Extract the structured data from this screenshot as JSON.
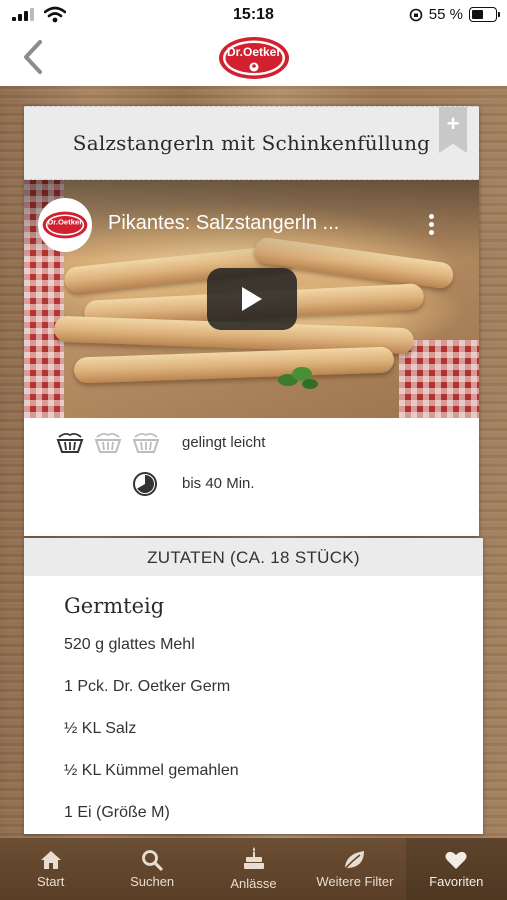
{
  "status": {
    "time": "15:18",
    "battery": "55 %",
    "battery_level": 0.55
  },
  "nav": {
    "logo_text": "Dr.Oetker"
  },
  "recipe": {
    "title": "Salzstangerln mit Schinkenfüllung",
    "bookmark_symbol": "+",
    "video": {
      "title": "Pikantes: Salzstangerln ...",
      "channel_logo_text": "Dr.Oetker"
    },
    "difficulty": {
      "label": "gelingt leicht",
      "level": 1,
      "max": 3
    },
    "duration": {
      "label": "bis 40 Min."
    }
  },
  "ingredients": {
    "header": "ZUTATEN (CA. 18 STÜCK)",
    "group_title": "Germteig",
    "items": [
      "520 g glattes Mehl",
      "1 Pck. Dr. Oetker Germ",
      "½ KL Salz",
      "½ KL Kümmel gemahlen",
      "1 Ei (Größe M)"
    ]
  },
  "tabs": [
    {
      "label": "Start",
      "icon": "home-icon"
    },
    {
      "label": "Suchen",
      "icon": "search-icon"
    },
    {
      "label": "Anlässe",
      "icon": "cake-icon"
    },
    {
      "label": "Weitere Filter",
      "icon": "leaf-icon"
    },
    {
      "label": "Favoriten",
      "icon": "heart-icon",
      "active": true
    }
  ],
  "colors": {
    "brand_red": "#d1202f",
    "tab_bar": "#5e422a",
    "title_band": "#ebebeb"
  }
}
